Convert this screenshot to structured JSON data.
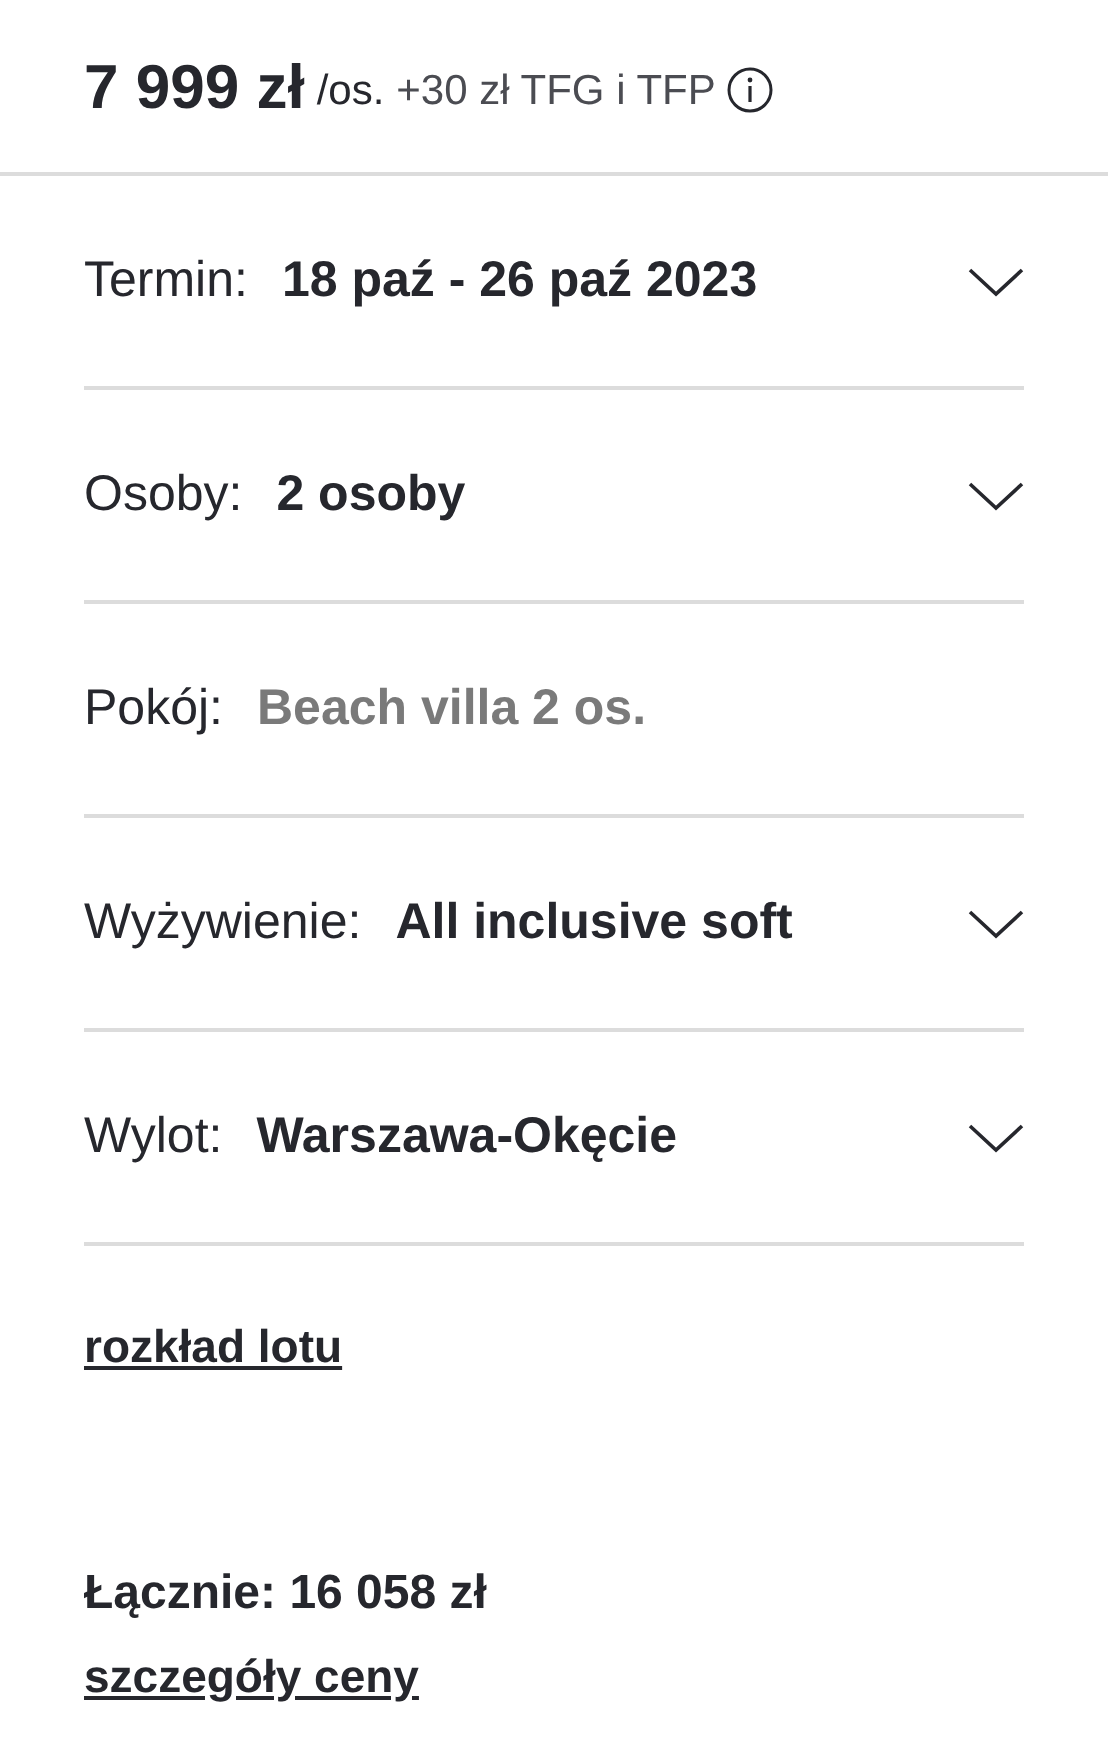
{
  "price": {
    "amount": "7 999 zł",
    "unit": "/os.",
    "extra": "+30 zł TFG i TFP"
  },
  "options": [
    {
      "label": "Termin:",
      "value": "18 paź - 26 paź 2023",
      "disabled": false
    },
    {
      "label": "Osoby:",
      "value": "2 osoby",
      "disabled": false
    },
    {
      "label": "Pokój:",
      "value": "Beach villa 2 os.",
      "disabled": true
    },
    {
      "label": "Wyżywienie:",
      "value": "All inclusive soft",
      "disabled": false
    },
    {
      "label": "Wylot:",
      "value": "Warszawa-Okęcie",
      "disabled": false
    }
  ],
  "flight_link": "rozkład lotu",
  "total": "Łącznie: 16 058 zł",
  "price_details_link": "szczegóły ceny"
}
